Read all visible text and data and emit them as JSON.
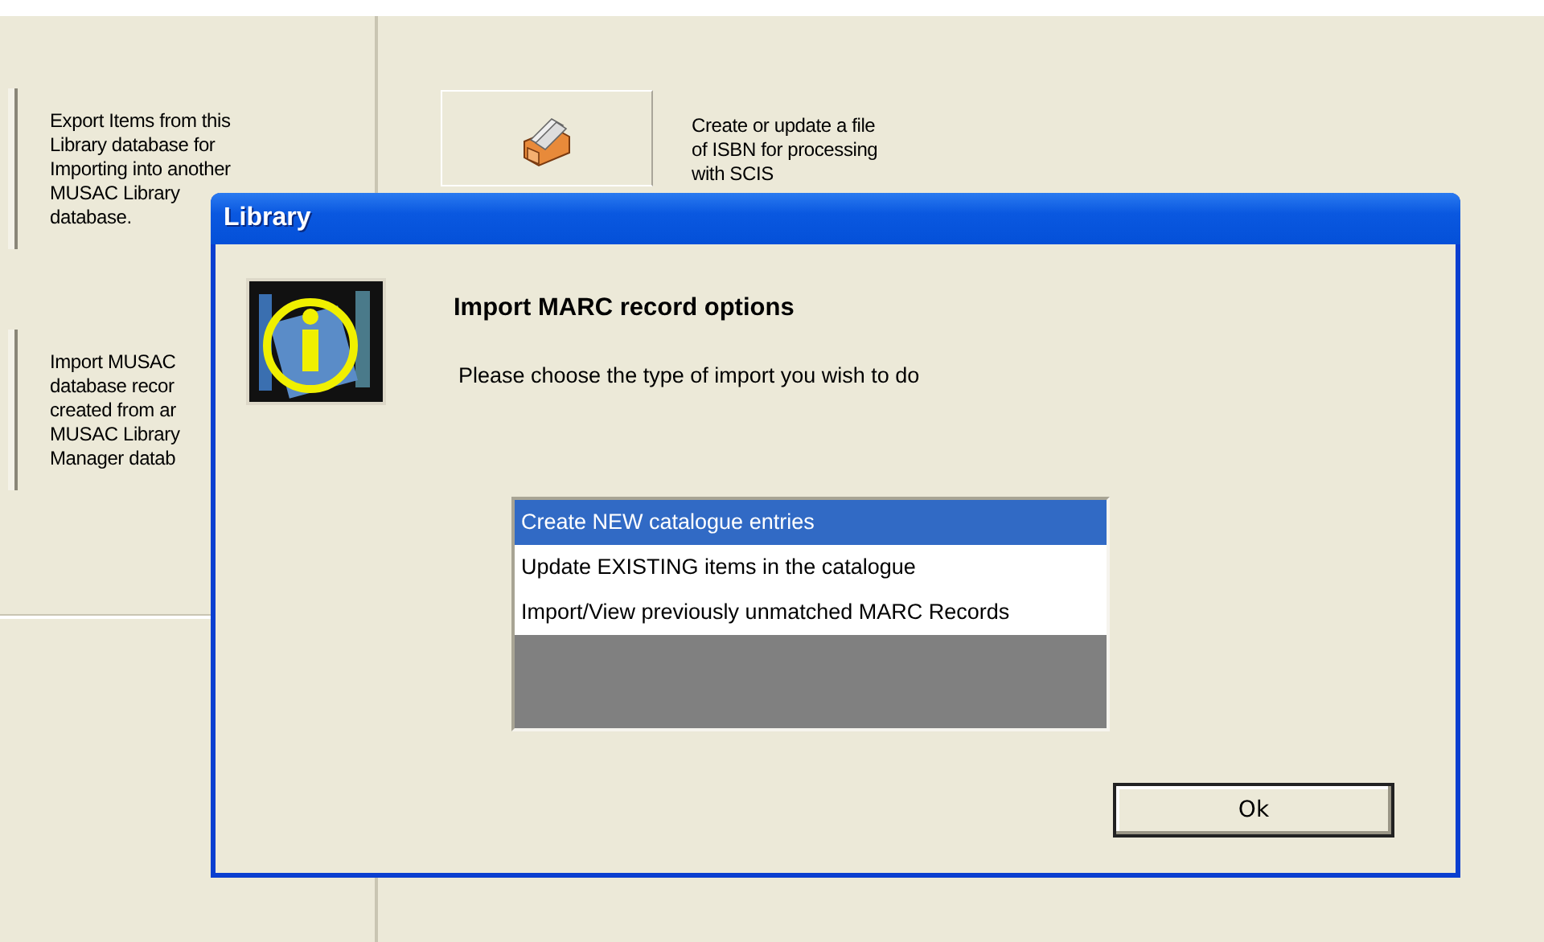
{
  "background": {
    "left_items": [
      {
        "lines": [
          "Export Items from this",
          "Library database for",
          "Importing into another",
          "MUSAC Library",
          "database."
        ]
      },
      {
        "lines": [
          "Import MUSAC",
          "database recor",
          "created from ar",
          "MUSAC Library",
          "Manager datab"
        ]
      }
    ],
    "right_items": [
      {
        "lines": [
          "Create or update a file",
          "of ISBN for processing",
          "with SCIS"
        ]
      }
    ]
  },
  "dialog": {
    "title": "Library",
    "heading": "Import MARC record options",
    "prompt": "Please choose the type of import you wish to do",
    "options": [
      {
        "label": "Create NEW catalogue entries",
        "selected": true
      },
      {
        "label": "Update EXISTING items in the catalogue",
        "selected": false
      },
      {
        "label": "Import/View previously unmatched MARC Records",
        "selected": false
      }
    ],
    "button": "Ok"
  }
}
